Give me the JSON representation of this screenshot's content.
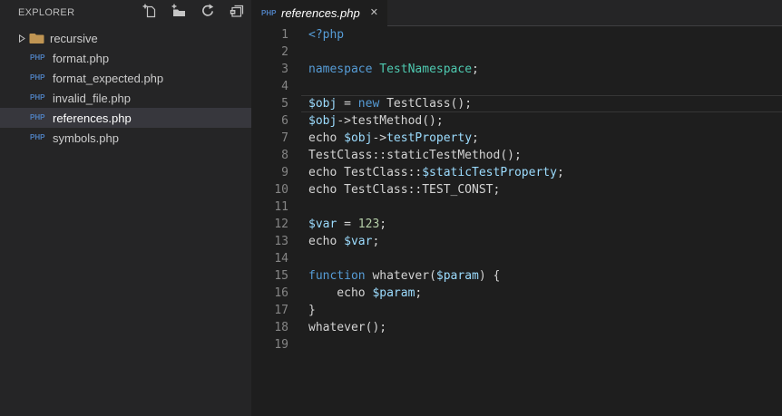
{
  "colors": {
    "editor_background": "#1E1E1E",
    "sidebar_background": "#252526",
    "selected_item_background": "#37373D",
    "tabbar_background": "#252526",
    "keyword": "#569CD6",
    "class_name": "#4EC9B0",
    "variable": "#9CDCFE",
    "number": "#B5CEA8",
    "plain_code": "#D4D4D4",
    "line_number": "#858585",
    "php_icon_blue": "#4E7FBE",
    "folder_icon_tan": "#C09553",
    "current_line_border": "#363636"
  },
  "icons": {
    "php_badge": "PHP"
  },
  "sidebar": {
    "title": "EXPLORER",
    "toolbar": [
      {
        "name": "new-file",
        "icon": "new-file-icon"
      },
      {
        "name": "new-folder",
        "icon": "new-folder-icon"
      },
      {
        "name": "refresh",
        "icon": "refresh-icon"
      },
      {
        "name": "collapse-all",
        "icon": "collapse-all-icon"
      }
    ],
    "items": [
      {
        "label": "recursive",
        "type": "folder",
        "collapsed": true,
        "selected": false
      },
      {
        "label": "format.php",
        "type": "php-file",
        "selected": false
      },
      {
        "label": "format_expected.php",
        "type": "php-file",
        "selected": false
      },
      {
        "label": "invalid_file.php",
        "type": "php-file",
        "selected": false
      },
      {
        "label": "references.php",
        "type": "php-file",
        "selected": true
      },
      {
        "label": "symbols.php",
        "type": "php-file",
        "selected": false
      }
    ]
  },
  "editor": {
    "tab": {
      "label": "references.php",
      "close_glyph": "✕",
      "preview": true
    },
    "language": "php",
    "lines": [
      {
        "num": "1",
        "tokens": [
          [
            "kw",
            "<?php"
          ]
        ]
      },
      {
        "num": "2",
        "tokens": []
      },
      {
        "num": "3",
        "tokens": [
          [
            "kw",
            "namespace"
          ],
          [
            "txt",
            " "
          ],
          [
            "cls",
            "TestNamespace"
          ],
          [
            "txt",
            ";"
          ]
        ]
      },
      {
        "num": "4",
        "tokens": []
      },
      {
        "num": "5",
        "current": true,
        "tokens": [
          [
            "var",
            "$obj"
          ],
          [
            "txt",
            " = "
          ],
          [
            "kw",
            "new"
          ],
          [
            "txt",
            " TestClass();"
          ]
        ]
      },
      {
        "num": "6",
        "tokens": [
          [
            "var",
            "$obj"
          ],
          [
            "txt",
            "->testMethod();"
          ]
        ]
      },
      {
        "num": "7",
        "tokens": [
          [
            "txt",
            "echo "
          ],
          [
            "var",
            "$obj"
          ],
          [
            "txt",
            "->"
          ],
          [
            "var",
            "testProperty"
          ],
          [
            "txt",
            ";"
          ]
        ]
      },
      {
        "num": "8",
        "tokens": [
          [
            "txt",
            "TestClass::staticTestMethod();"
          ]
        ]
      },
      {
        "num": "9",
        "tokens": [
          [
            "txt",
            "echo TestClass::"
          ],
          [
            "var",
            "$staticTestProperty"
          ],
          [
            "txt",
            ";"
          ]
        ]
      },
      {
        "num": "10",
        "tokens": [
          [
            "txt",
            "echo TestClass::TEST_CONST;"
          ]
        ]
      },
      {
        "num": "11",
        "tokens": []
      },
      {
        "num": "12",
        "tokens": [
          [
            "var",
            "$var"
          ],
          [
            "txt",
            " = "
          ],
          [
            "num",
            "123"
          ],
          [
            "txt",
            ";"
          ]
        ]
      },
      {
        "num": "13",
        "tokens": [
          [
            "txt",
            "echo "
          ],
          [
            "var",
            "$var"
          ],
          [
            "txt",
            ";"
          ]
        ]
      },
      {
        "num": "14",
        "tokens": []
      },
      {
        "num": "15",
        "tokens": [
          [
            "kw",
            "function"
          ],
          [
            "txt",
            " whatever("
          ],
          [
            "var",
            "$param"
          ],
          [
            "txt",
            ") {"
          ]
        ]
      },
      {
        "num": "16",
        "tokens": [
          [
            "txt",
            "    echo "
          ],
          [
            "var",
            "$param"
          ],
          [
            "txt",
            ";"
          ]
        ]
      },
      {
        "num": "17",
        "tokens": [
          [
            "txt",
            "}"
          ]
        ]
      },
      {
        "num": "18",
        "tokens": [
          [
            "txt",
            "whatever();"
          ]
        ]
      },
      {
        "num": "19",
        "tokens": []
      }
    ]
  }
}
